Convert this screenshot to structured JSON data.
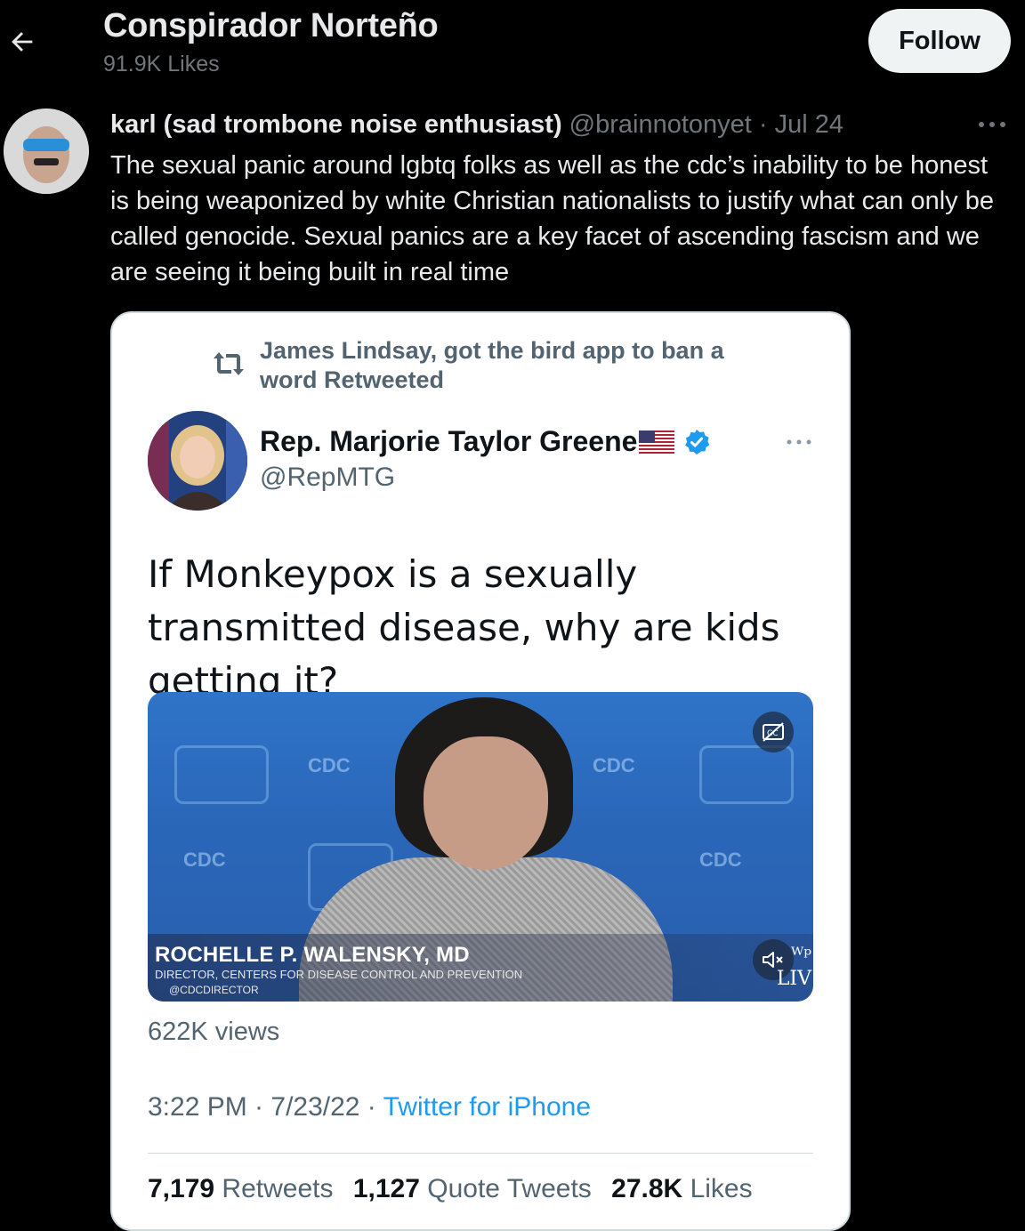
{
  "header": {
    "title": "Conspirador Norteño",
    "likes": "91.9K Likes",
    "follow_label": "Follow"
  },
  "tweet": {
    "author_name": "karl (sad trombone noise enthusiast)",
    "handle_date": " @brainnotonyet · Jul 24",
    "text": "The sexual panic around lgbtq folks as well as the cdc’s inability to be honest is being weaponized by white Christian nationalists to justify what can only be called genocide. Sexual panics are a key facet of ascending fascism and we are seeing it being built in real time"
  },
  "quoted": {
    "retweeted_by": "James Lindsay, got the bird app to ban a word Retweeted",
    "author_name": "Rep. Marjorie Taylor Greene",
    "handle": "@RepMTG",
    "text": "If Monkeypox is a sexually transmitted disease, why are kids getting it?",
    "video": {
      "name_caption": "ROCHELLE P. WALENSKY, MD",
      "title_caption": "DIRECTOR, CENTERS FOR DISEASE CONTROL AND PREVENTION",
      "handle_caption": "@CDCDIRECTOR",
      "wp_logo": "ᵂᵖ LIV"
    },
    "views": "622K views",
    "time_date": "3:22 PM · 7/23/22 · ",
    "source": "Twitter for iPhone",
    "stats": {
      "retweets_count": "7,179",
      "retweets_label": "Retweets",
      "quotes_count": "1,127",
      "quotes_label": "Quote Tweets",
      "likes_count": "27.8K",
      "likes_label": "Likes"
    }
  },
  "colors": {
    "background": "#000000",
    "card": "#ffffff",
    "link": "#1d9bf0",
    "muted": "#71767b",
    "verified": "#1d9bf0"
  }
}
